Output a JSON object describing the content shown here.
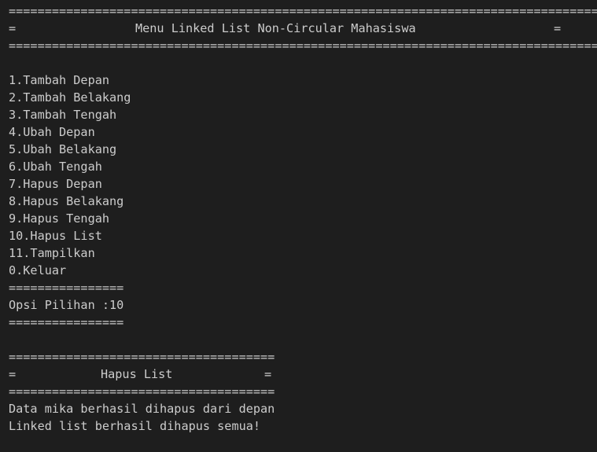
{
  "header": {
    "separator": "===================================================================================",
    "left_edge": "=",
    "right_edge": "=",
    "title": "Menu Linked List Non-Circular Mahasiswa"
  },
  "menu": {
    "items": [
      "1.Tambah Depan",
      "2.Tambah Belakang",
      "3.Tambah Tengah",
      "4.Ubah Depan",
      "5.Ubah Belakang",
      "6.Ubah Tengah",
      "7.Hapus Depan",
      "8.Hapus Belakang",
      "9.Hapus Tengah",
      "10.Hapus List",
      "11.Tampilkan",
      "0.Keluar"
    ],
    "short_separator": "================"
  },
  "prompt": {
    "text": "Opsi Pilihan :10"
  },
  "section": {
    "separator": "=====================================",
    "left_edge": "=",
    "right_edge": "=",
    "title": "Hapus List"
  },
  "messages": [
    "Data mika berhasil dihapus dari depan",
    "Linked list berhasil dihapus semua!"
  ]
}
